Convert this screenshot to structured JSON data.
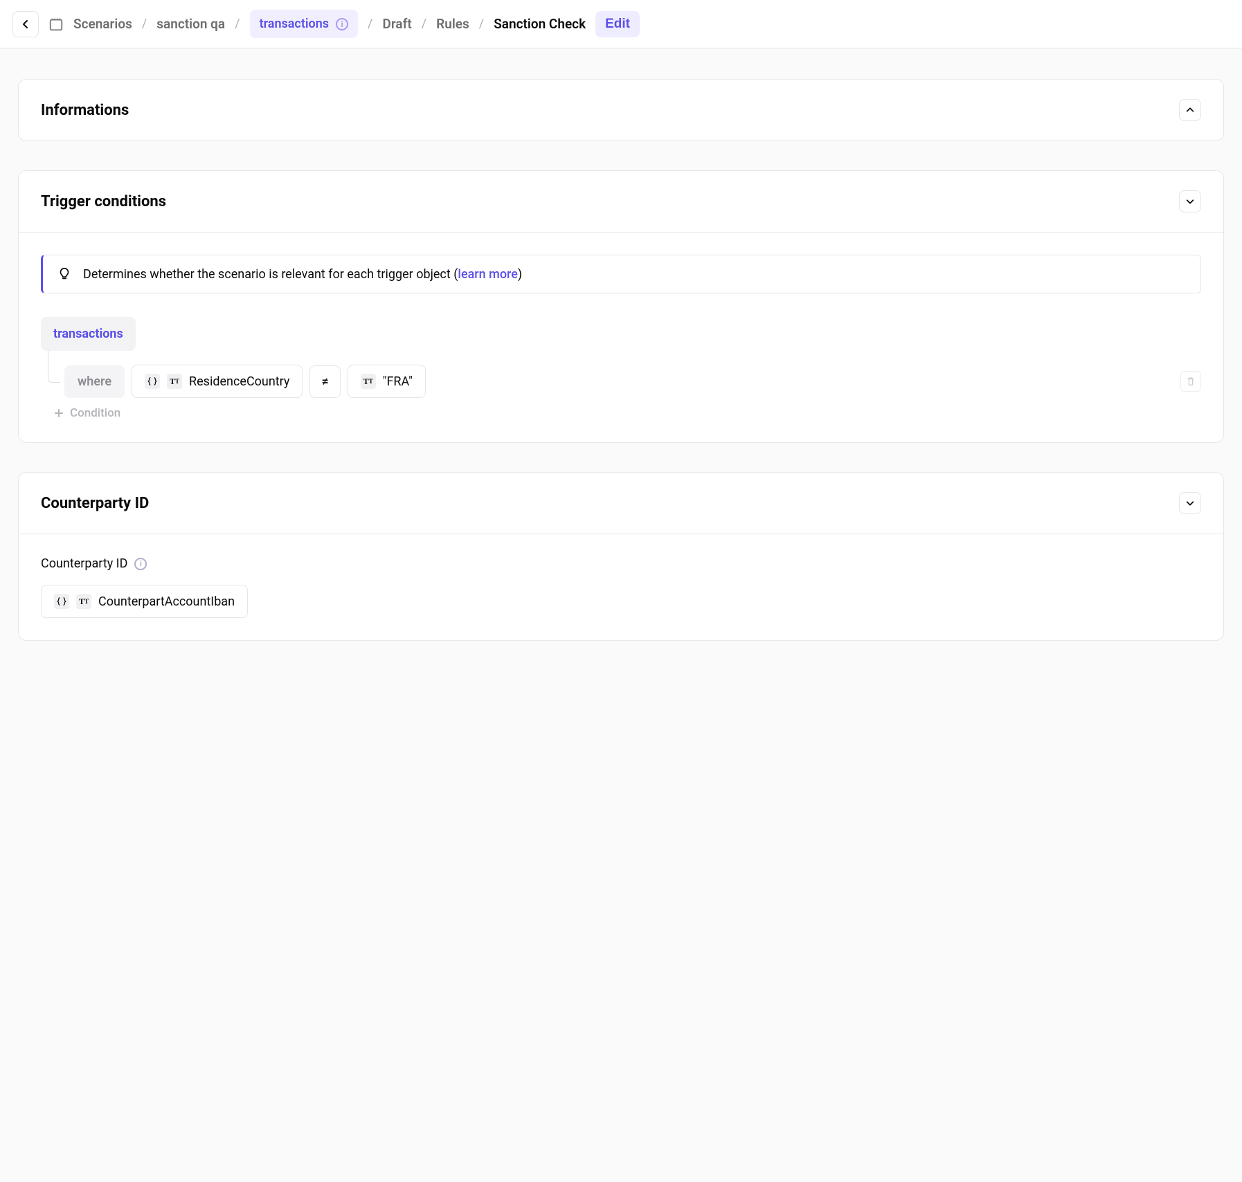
{
  "breadcrumbs": {
    "scenarios": "Scenarios",
    "scenario": "sanction qa",
    "trigger": "transactions",
    "draft": "Draft",
    "rules": "Rules",
    "current": "Sanction Check",
    "edit": "Edit"
  },
  "sections": {
    "informations": {
      "title": "Informations"
    },
    "trigger": {
      "title": "Trigger conditions",
      "hint_prefix": "Determines whether the scenario is relevant for each trigger object (",
      "hint_link": "learn more",
      "hint_suffix": ")",
      "object": "transactions",
      "where_label": "where",
      "field": "ResidenceCountry",
      "operator": "≠",
      "value": "\"FRA\"",
      "add_label": "Condition"
    },
    "counterparty": {
      "title": "Counterparty ID",
      "label": "Counterparty ID",
      "field": "CounterpartAccountIban"
    }
  }
}
